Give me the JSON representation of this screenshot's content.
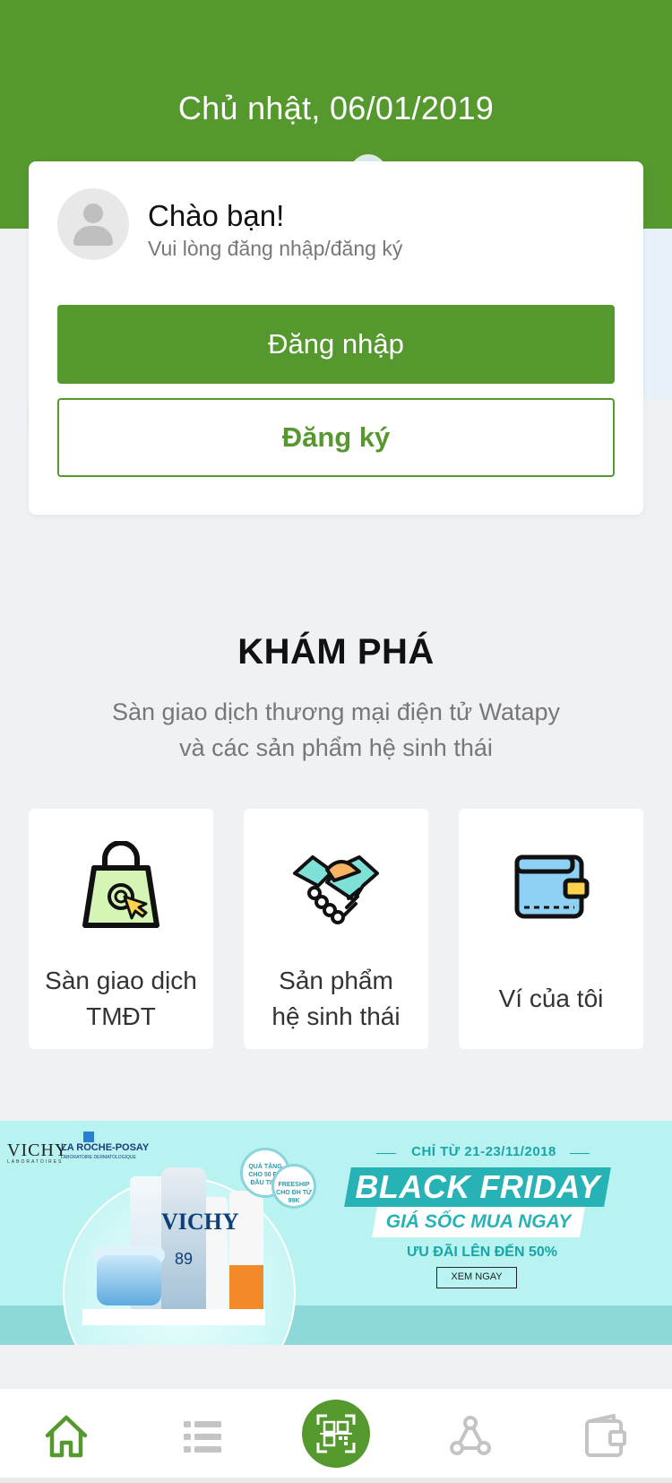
{
  "header": {
    "date": "Chủ nhật, 06/01/2019",
    "background_color": "#55982e"
  },
  "account_card": {
    "greeting": "Chào bạn!",
    "subtitle": "Vui lòng đăng nhập/đăng ký",
    "login_label": "Đăng nhập",
    "register_label": "Đăng ký",
    "accent_color": "#55982e"
  },
  "explore": {
    "title": "KHÁM PHÁ",
    "description_line1": "Sàn giao dịch thương mại điện tử Watapy",
    "description_line2": "và các sản phẩm hệ sinh thái",
    "tiles": [
      {
        "line1": "Sàn giao dịch",
        "line2": "TMĐT",
        "icon": "shopping-bag-icon"
      },
      {
        "line1": "Sản phẩm",
        "line2": "hệ sinh thái",
        "icon": "handshake-icon"
      },
      {
        "line1": "Ví của tôi",
        "line2": "",
        "icon": "wallet-icon"
      }
    ]
  },
  "banner": {
    "brand_left": "VICHY",
    "brand_left_sub": "LABORATOIRES",
    "brand_right": "LA ROCHE-POSAY",
    "brand_right_sub": "LABORATOIRE DERMATOLOGIQUE",
    "bubble_gift": "QUÀ TẶNG CHO 50 ĐH ĐẦU TIÊN",
    "bubble_ship": "FREESHIP CHO ĐH TỪ 99K",
    "product_brand": "VICHY",
    "product_number": "89",
    "date_range": "CHỈ TỪ 21-23/11/2018",
    "headline": "BLACK FRIDAY",
    "subheadline": "GIÁ SỐC MUA NGAY",
    "offer": "ƯU ĐÃI LÊN ĐẾN 50%",
    "cta": "XEM NGAY"
  },
  "bottom_nav": {
    "items": [
      {
        "icon": "home-icon",
        "active": true
      },
      {
        "icon": "list-icon",
        "active": false
      },
      {
        "icon": "qr-scan-icon",
        "active": false
      },
      {
        "icon": "network-icon",
        "active": false
      },
      {
        "icon": "wallet-icon",
        "active": false
      }
    ]
  }
}
